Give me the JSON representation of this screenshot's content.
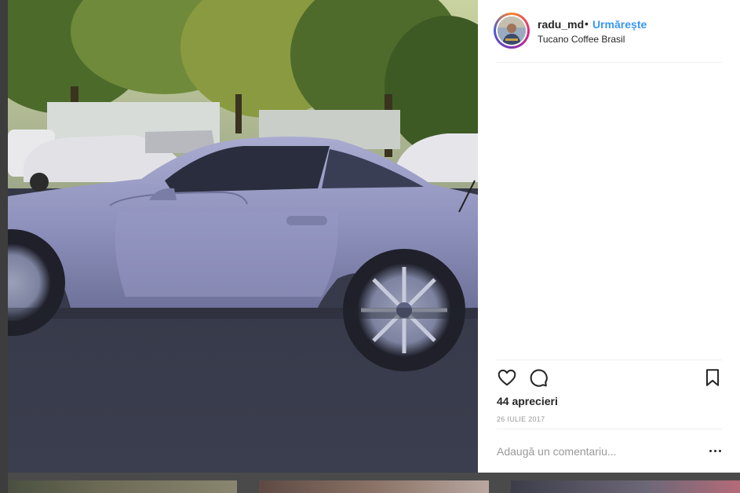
{
  "post": {
    "username": "radu_md",
    "separator": "•",
    "follow_label": "Urmărește",
    "location": "Tucano Coffee Brasil",
    "likes": "44 aprecieri",
    "date": "26 IULIE 2017",
    "comment_placeholder": "Adaugă un comentariu..."
  },
  "icons": {
    "like": "heart-icon",
    "comment": "comment-icon",
    "save": "bookmark-icon",
    "more": "more-options-icon"
  },
  "colors": {
    "follow": "#3897f0",
    "text": "#262626",
    "muted": "#999999"
  }
}
